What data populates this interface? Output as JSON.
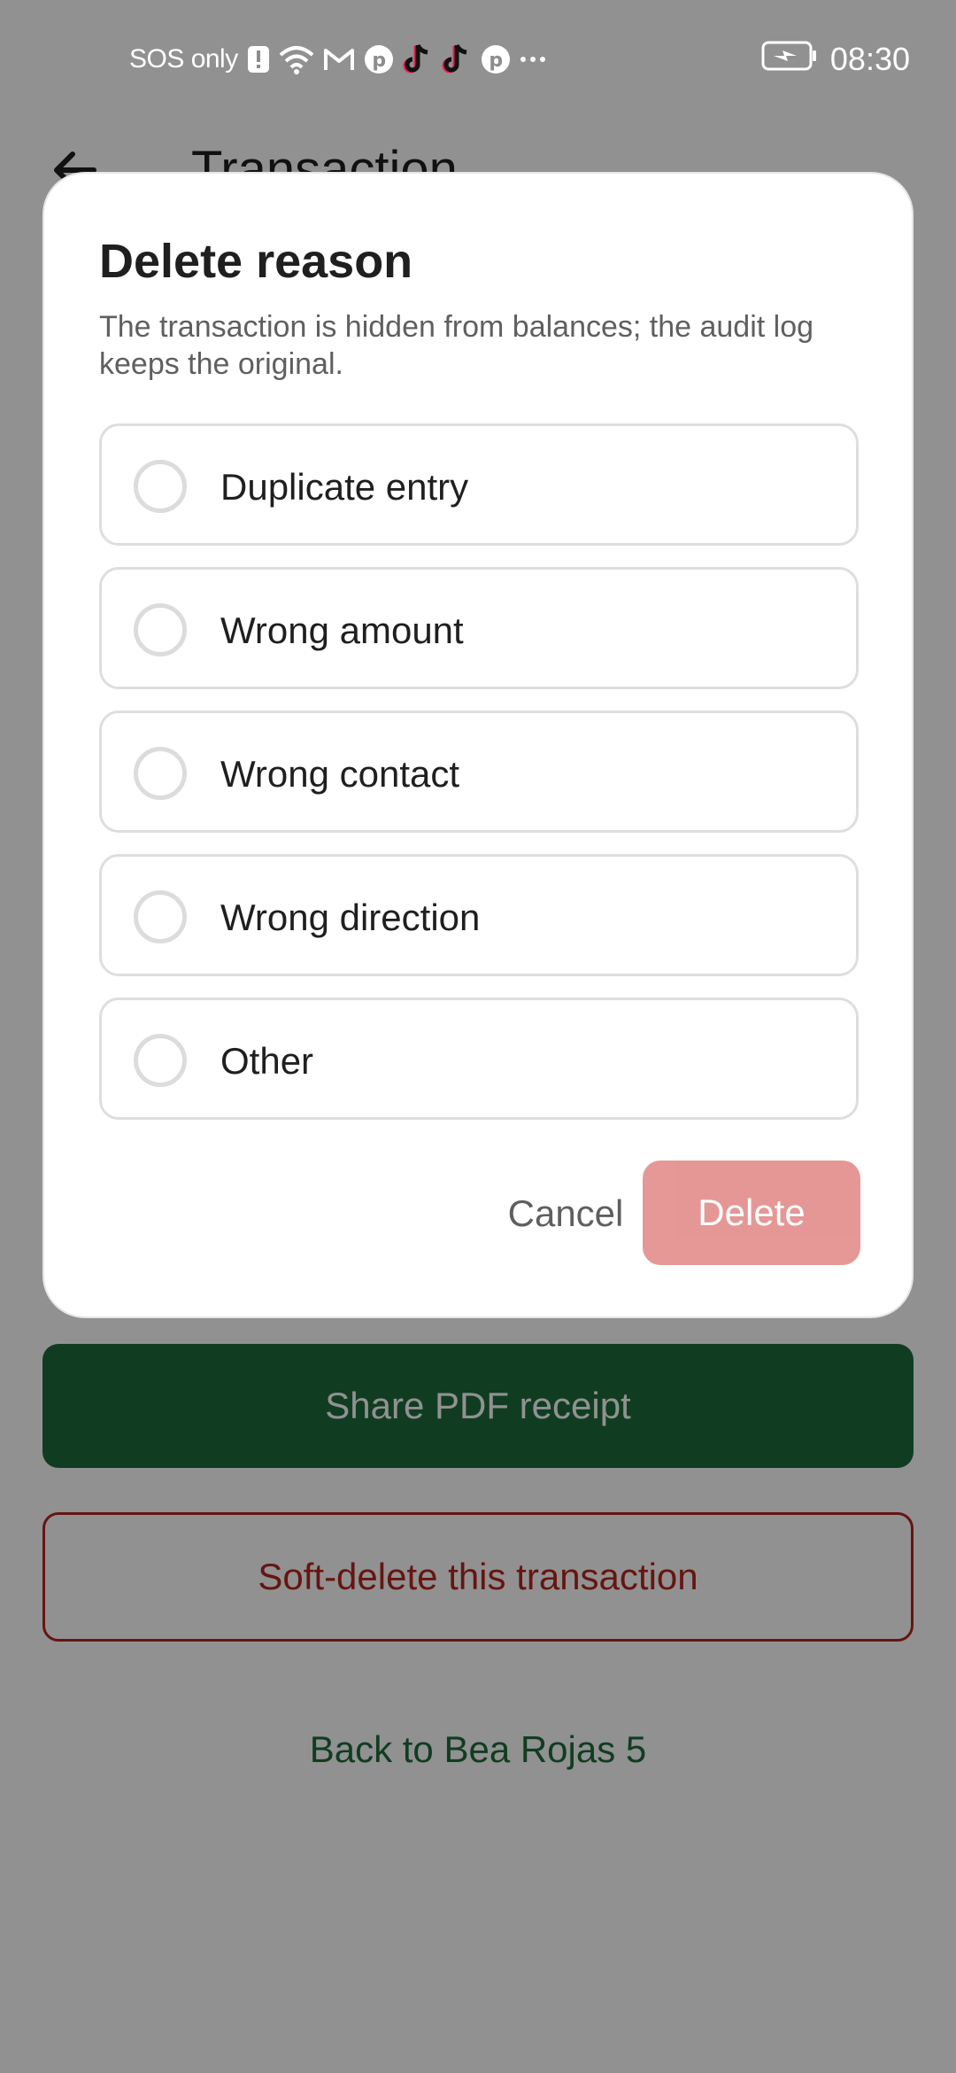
{
  "status_bar": {
    "carrier": "SOS only",
    "time": "08:30",
    "icons": [
      "alert-icon",
      "wifi-icon",
      "gmail-icon",
      "pinterest-icon",
      "tiktok-icon",
      "tiktok-icon",
      "pinterest-icon",
      "more-icon",
      "battery-charging-icon"
    ]
  },
  "page": {
    "title": "Transaction",
    "share_label": "Share PDF receipt",
    "softdelete_label": "Soft-delete this transaction",
    "back_link_label": "Back to Bea Rojas 5"
  },
  "dialog": {
    "title": "Delete reason",
    "description": "The transaction is hidden from balances; the audit log keeps the original.",
    "options": [
      {
        "label": "Duplicate entry",
        "selected": false
      },
      {
        "label": "Wrong amount",
        "selected": false
      },
      {
        "label": "Wrong contact",
        "selected": false
      },
      {
        "label": "Wrong direction",
        "selected": false
      },
      {
        "label": "Other",
        "selected": false
      }
    ],
    "cancel_label": "Cancel",
    "delete_label": "Delete",
    "delete_enabled": false
  },
  "colors": {
    "accent_green": "#1d6b3b",
    "danger_red": "#b3261e",
    "delete_disabled": "#e49290",
    "scrim": "rgba(0,0,0,0.43)"
  }
}
